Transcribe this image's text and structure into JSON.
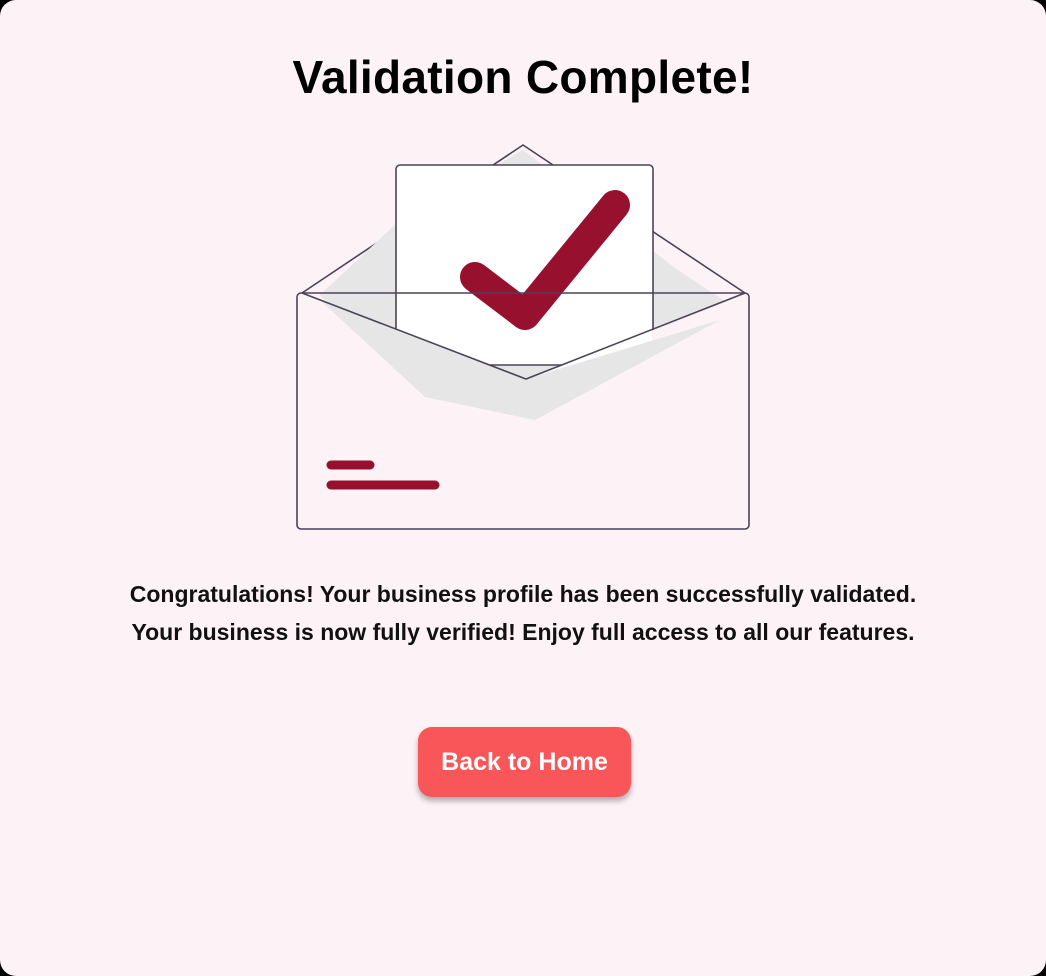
{
  "title": "Validation Complete!",
  "message": {
    "line1": "Congratulations! Your business profile has been successfully validated.",
    "line2": "Your business is now fully verified! Enjoy full access to all our features."
  },
  "button": {
    "label": "Back to Home"
  },
  "colors": {
    "background": "#fdf2f6",
    "accent": "#97112f",
    "button": "#f85658",
    "outline": "#4a4358"
  },
  "illustration": {
    "icon": "envelope-checkmark-icon"
  }
}
